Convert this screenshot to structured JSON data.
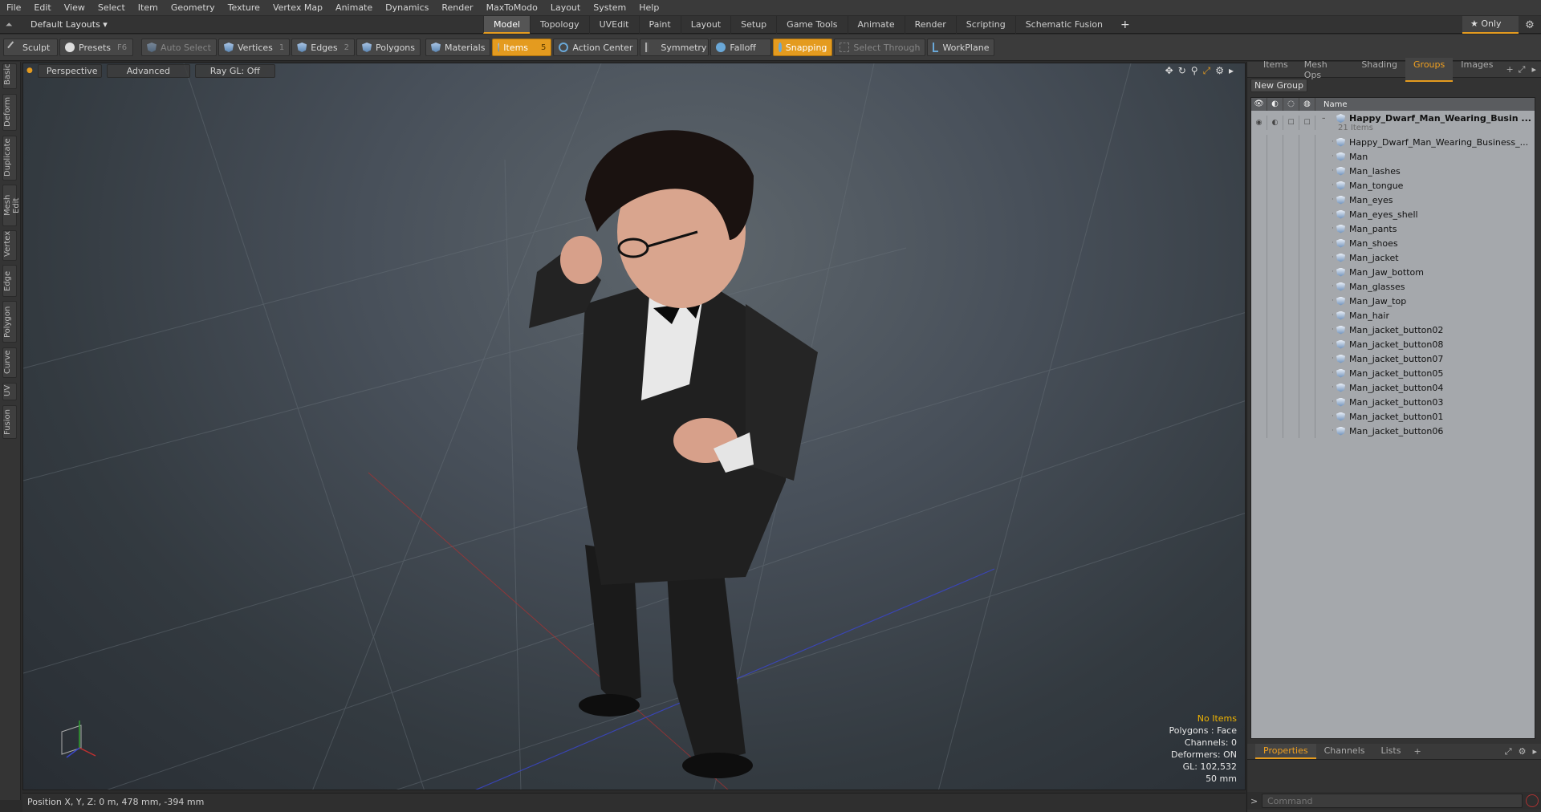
{
  "menubar": [
    "File",
    "Edit",
    "View",
    "Select",
    "Item",
    "Geometry",
    "Texture",
    "Vertex Map",
    "Animate",
    "Dynamics",
    "Render",
    "MaxToModo",
    "Layout",
    "System",
    "Help"
  ],
  "layouts": {
    "label": "Default Layouts ▾"
  },
  "tabs": [
    "Model",
    "Topology",
    "UVEdit",
    "Paint",
    "Layout",
    "Setup",
    "Game Tools",
    "Animate",
    "Render",
    "Scripting",
    "Schematic Fusion"
  ],
  "active_tab": "Model",
  "only_label": "★ Only",
  "toolbar": {
    "sculpt": "Sculpt",
    "presets": "Presets",
    "presets_key": "F6",
    "auto_select": "Auto Select",
    "vertices": "Vertices",
    "vertices_key": "1",
    "edges": "Edges",
    "edges_key": "2",
    "polygons": "Polygons",
    "materials": "Materials",
    "items": "Items",
    "items_key": "5",
    "action_center": "Action Center",
    "symmetry": "Symmetry",
    "falloff": "Falloff",
    "snapping": "Snapping",
    "select_through": "Select Through",
    "workplane": "WorkPlane"
  },
  "left_tabs": [
    "Basic",
    "Deform",
    "Duplicate",
    "Mesh Edit",
    "Vertex",
    "Edge",
    "Polygon",
    "Curve",
    "UV",
    "Fusion"
  ],
  "viewport": {
    "view": "Perspective",
    "mode": "Advanced",
    "raygl": "Ray GL: Off",
    "stats": {
      "no_items": "No Items",
      "polygons": "Polygons : Face",
      "channels": "Channels: 0",
      "deformers": "Deformers: ON",
      "gl": "GL: 102,532",
      "focal": "50 mm"
    }
  },
  "status": {
    "position": "Position X, Y, Z:  0 m, 478 mm, -394 mm"
  },
  "right_panel": {
    "tabs": [
      "Items",
      "Mesh Ops",
      "Shading",
      "Groups",
      "Images"
    ],
    "active_tab": "Groups",
    "new_group": "New Group",
    "column_name": "Name",
    "root": {
      "name": "Happy_Dwarf_Man_Wearing_Busin ...",
      "count": "21 Items"
    },
    "items": [
      "Happy_Dwarf_Man_Wearing_Business_...",
      "Man",
      "Man_lashes",
      "Man_tongue",
      "Man_eyes",
      "Man_eyes_shell",
      "Man_pants",
      "Man_shoes",
      "Man_jacket",
      "Man_Jaw_bottom",
      "Man_glasses",
      "Man_Jaw_top",
      "Man_hair",
      "Man_jacket_button02",
      "Man_jacket_button08",
      "Man_jacket_button07",
      "Man_jacket_button05",
      "Man_jacket_button04",
      "Man_jacket_button03",
      "Man_jacket_button01",
      "Man_jacket_button06"
    ],
    "bottom_tabs": [
      "Properties",
      "Channels",
      "Lists"
    ],
    "bottom_active": "Properties",
    "command_placeholder": "Command"
  }
}
